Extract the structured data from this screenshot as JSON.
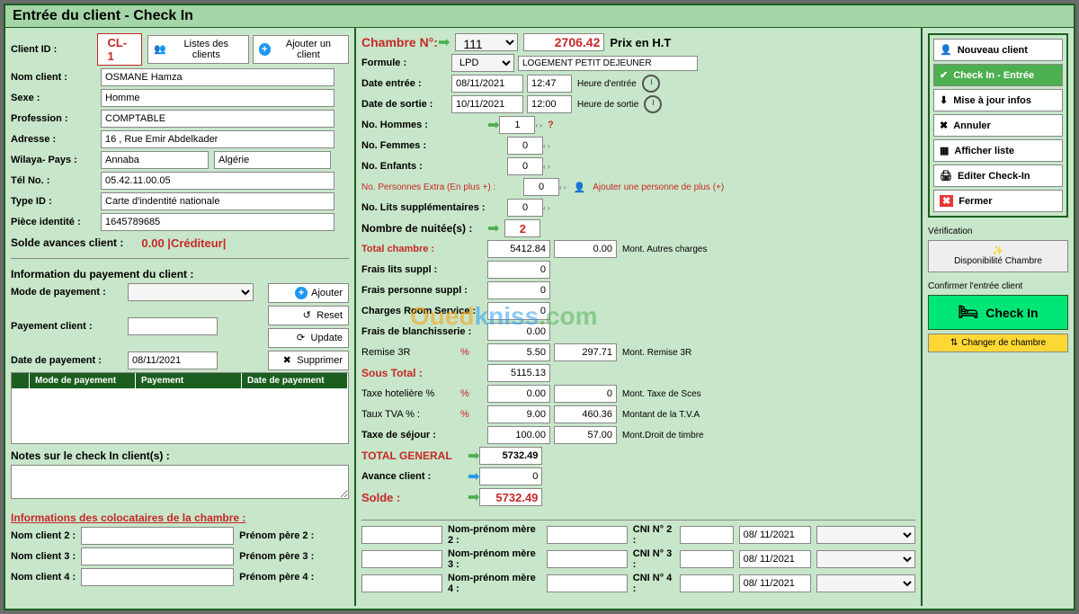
{
  "title": "Entrée du client - Check In",
  "client": {
    "id_label": "Client ID :",
    "id_value": "CL-1",
    "list_btn": "Listes des clients",
    "add_btn": "Ajouter un client",
    "nom_label": "Nom client :",
    "nom_value": "OSMANE Hamza",
    "sexe_label": "Sexe :",
    "sexe_value": "Homme",
    "prof_label": "Profession :",
    "prof_value": "COMPTABLE",
    "adr_label": "Adresse :",
    "adr_value": "16 , Rue Emir Abdelkader",
    "wilaya_label": "Wilaya- Pays :",
    "wilaya_value": "Annaba",
    "pays_value": "Algérie",
    "tel_label": "Tél No. :",
    "tel_value": "05.42.11.00.05",
    "typeid_label": "Type ID :",
    "typeid_value": "Carte d'indentité nationale",
    "piece_label": "Pièce identité :",
    "piece_value": "1645789685",
    "solde_label": "Solde avances client :",
    "solde_value": "0.00 |Créditeur|"
  },
  "payment": {
    "section": "Information du payement du client :",
    "mode_label": "Mode de payement :",
    "add_btn": "Ajouter",
    "reset_btn": "Reset",
    "update_btn": "Update",
    "delete_btn": "Supprimer",
    "client_label": "Payement client :",
    "date_label": "Date de payement :",
    "date_value": "08/11/2021",
    "table": {
      "col1": "Mode de payement",
      "col2": "Payement",
      "col3": "Date de payement"
    },
    "notes_label": "Notes sur le check In client(s) :"
  },
  "room": {
    "chambre_label": "Chambre N°:",
    "chambre_value": "111",
    "prix_value": "2706.42",
    "prix_label": "Prix en H.T",
    "formule_label": "Formule :",
    "formule_code": "LPD",
    "formule_desc": "LOGEMENT PETIT DEJEUNER",
    "date_in_label": "Date entrée :",
    "date_in": "08/11/2021",
    "time_in": "12:47",
    "time_in_label": "Heure d'entrée",
    "date_out_label": "Date de sortie :",
    "date_out": "10/11/2021",
    "time_out": "12:00",
    "time_out_label": "Heure de sortie",
    "hommes_label": "No. Hommes :",
    "hommes": "1",
    "femmes_label": "No. Femmes :",
    "femmes": "0",
    "enfants_label": "No. Enfants :",
    "enfants": "0",
    "extra_label": "No. Personnes Extra (En plus +) :",
    "extra": "0",
    "extra_hint": "Ajouter une personne de plus (+)",
    "lits_label": "No. Lits supplémentaires :",
    "lits": "0",
    "nuits_label": "Nombre de nuitée(s) :",
    "nuits": "2"
  },
  "charges": {
    "total_ch_label": "Total chambre :",
    "total_ch": "5412.84",
    "autres": "0.00",
    "autres_label": "Mont. Autres charges",
    "lits_label": "Frais lits suppl :",
    "lits": "0",
    "pers_label": "Frais personne suppl :",
    "pers": "0",
    "room_label": "Charges Room Service :",
    "room": "0",
    "blanch_label": "Frais de blanchisserie :",
    "blanch": "0.00",
    "remise_label": "Remise 3R",
    "remise_pct": "5.50",
    "remise_val": "297.71",
    "remise_hint": "Mont. Remise 3R",
    "soustotal_label": "Sous Total :",
    "soustotal": "5115.13",
    "taxe_hot_label": "Taxe hotelière %",
    "taxe_hot": "0.00",
    "taxe_hot_val": "0",
    "taxe_hot_hint": "Mont. Taxe de Sces",
    "tva_label": "Taux TVA % :",
    "tva": "9.00",
    "tva_val": "460.36",
    "tva_hint": "Montant de la T.V.A",
    "sejour_label": "Taxe de séjour :",
    "sejour": "100.00",
    "sejour_val": "57.00",
    "sejour_hint": "Mont.Droit de timbre",
    "total_gen_label": "TOTAL GENERAL",
    "total_gen": "5732.49",
    "avance_label": "Avance client :",
    "avance": "0",
    "solde_label": "Solde :",
    "solde": "5732.49"
  },
  "coloc": {
    "section": "Informations des colocataires de la chambre :",
    "rows": [
      {
        "nom_l": "Nom client 2 :",
        "pere_l": "Prénom père 2 :",
        "mere_l": "Nom-prénom mère 2 :",
        "cni_l": "CNI N° 2 :",
        "date": "08/ 11/2021"
      },
      {
        "nom_l": "Nom client 3 :",
        "pere_l": "Prénom père 3 :",
        "mere_l": "Nom-prénom mère 3 :",
        "cni_l": "CNI N° 3 :",
        "date": "08/ 11/2021"
      },
      {
        "nom_l": "Nom client 4 :",
        "pere_l": "Prénom père 4 :",
        "mere_l": "Nom-prénom mère 4 :",
        "cni_l": "CNI N° 4 :",
        "date": "08/ 11/2021"
      }
    ]
  },
  "sidebar": {
    "nouveau": "Nouveau client",
    "checkin": "Check In - Entrée",
    "maj": "Mise à jour infos",
    "annuler": "Annuler",
    "afficher": "Afficher liste",
    "editer": "Editer Check-In",
    "fermer": "Fermer",
    "verif_label": "Vérification",
    "dispo": "Disponibilité Chambre",
    "confirm_label": "Confirmer l'entrée client",
    "checkin_btn": "Check In",
    "changer": "Changer de chambre"
  }
}
